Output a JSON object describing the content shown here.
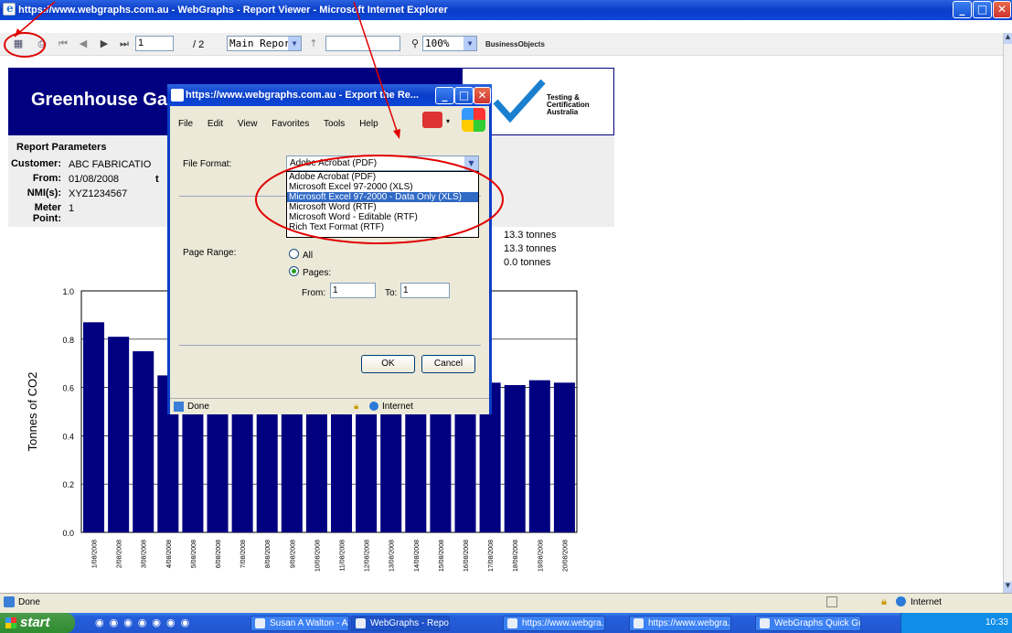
{
  "window": {
    "title": "https://www.webgraphs.com.au - WebGraphs - Report Viewer - Microsoft Internet Explorer"
  },
  "toolbar": {
    "page_value": "1",
    "page_total": "/ 2",
    "report_select": "Main Report",
    "zoom_select": "100%",
    "brand": "BusinessObjects"
  },
  "report": {
    "title": "Greenhouse Gas",
    "logo_text": [
      "Testing &",
      "Certification",
      "Australia"
    ],
    "params_heading": "Report Parameters",
    "params": [
      {
        "label": "Customer:",
        "value": "ABC FABRICATIO"
      },
      {
        "label": "From:",
        "value": "01/08/2008"
      },
      {
        "label": "NMI(s):",
        "value": "XYZ1234567"
      },
      {
        "label": "Meter Point:",
        "value": "1"
      }
    ],
    "from_to_fragment": "t",
    "summary": [
      "13.3 tonnes",
      "13.3 tonnes",
      "0.0 tonnes"
    ]
  },
  "chart_data": {
    "type": "bar",
    "ylabel": "Tonnes of CO2",
    "ylim": [
      0,
      1.0
    ],
    "yticks": [
      "0.0",
      "0.2",
      "0.4",
      "0.6",
      "0.8",
      "1.0"
    ],
    "categories": [
      "1/08/2008",
      "2/08/2008",
      "3/08/2008",
      "4/08/2008",
      "5/08/2008",
      "6/08/2008",
      "7/08/2008",
      "8/08/2008",
      "9/08/2008",
      "10/08/2008",
      "11/08/2008",
      "12/08/2008",
      "13/08/2008",
      "14/08/2008",
      "15/08/2008",
      "16/08/2008",
      "17/08/2008",
      "18/08/2008",
      "19/08/2008",
      "20/08/2008"
    ],
    "values": [
      0.87,
      0.81,
      0.75,
      0.65,
      0.64,
      0.64,
      0.64,
      0.64,
      0.64,
      0.64,
      0.64,
      0.64,
      0.63,
      0.63,
      0.63,
      0.63,
      0.62,
      0.61,
      0.63,
      0.62
    ],
    "bar_color": "#000080"
  },
  "dialog": {
    "title": "https://www.webgraphs.com.au - Export the Re...",
    "menu": [
      "File",
      "Edit",
      "View",
      "Favorites",
      "Tools",
      "Help"
    ],
    "file_format_label": "File Format:",
    "file_format_value": "Adobe Acrobat (PDF)",
    "format_options": [
      "Adobe Acrobat (PDF)",
      "Microsoft Excel 97-2000 (XLS)",
      "Microsoft Excel 97-2000 - Data Only (XLS)",
      "Microsoft Word (RTF)",
      "Microsoft Word - Editable (RTF)",
      "Rich Text Format (RTF)"
    ],
    "selected_option_index": 2,
    "page_range_label": "Page Range:",
    "radio_all": "All",
    "radio_pages": "Pages:",
    "from_label": "From:",
    "from_value": "1",
    "to_label": "To:",
    "to_value": "1",
    "ok": "OK",
    "cancel": "Cancel",
    "status_left": "Done",
    "status_zone": "Internet"
  },
  "status": {
    "left": "Done",
    "zone": "Internet"
  },
  "taskbar": {
    "start": "start",
    "tasks": [
      "Susan A Walton - All ...",
      "WebGraphs - Report ...",
      "https://www.webgra...",
      "https://www.webgra...",
      "WebGraphs Quick Gui..."
    ],
    "time": "10:33"
  },
  "colors": {
    "banner": "#000080",
    "annotation": "#e00000",
    "selection": "#316ac5"
  }
}
